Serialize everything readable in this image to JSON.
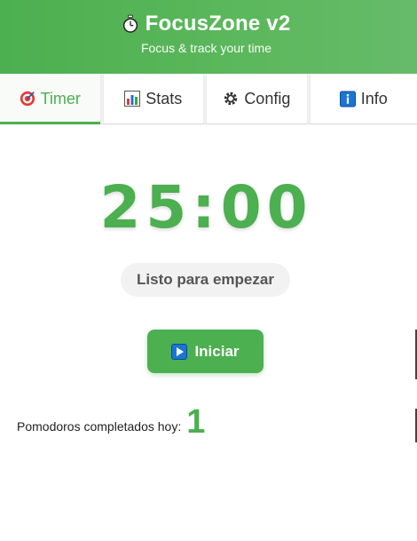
{
  "app": {
    "title": "FocusZone v2",
    "subtitle": "Focus & track your time",
    "title_icon": "stopwatch-icon"
  },
  "tabs": [
    {
      "label": "Timer",
      "icon": "target-icon",
      "active": true
    },
    {
      "label": "Stats",
      "icon": "bar-chart-icon",
      "active": false
    },
    {
      "label": "Config",
      "icon": "gear-icon",
      "active": false
    },
    {
      "label": "Info",
      "icon": "info-icon",
      "active": false
    }
  ],
  "timer": {
    "display": "25:00",
    "status": "Listo para empezar",
    "start_label": "Iniciar"
  },
  "stats": {
    "completed_label": "Pomodoros completados hoy:",
    "completed_count": "1"
  },
  "colors": {
    "accent": "#4caf50",
    "info_blue": "#1976d2"
  }
}
